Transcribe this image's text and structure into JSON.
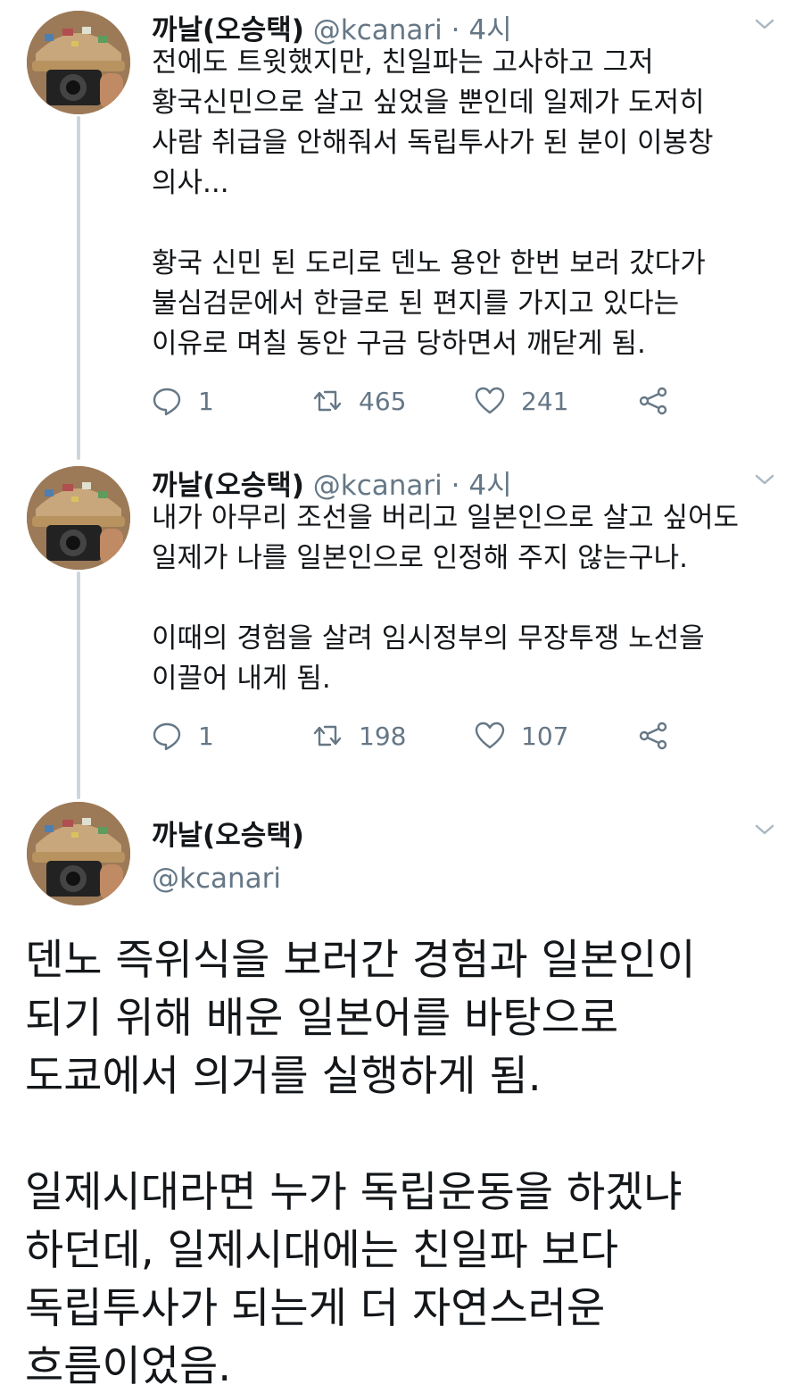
{
  "tweets": [
    {
      "name": "까날(오승택)",
      "handle": "@kcanari",
      "separator": "·",
      "time": "4시",
      "text": "전에도 트윗했지만, 친일파는 고사하고 그저\n황국신민으로 살고 싶었을 뿐인데 일제가 도저히\n사람 취급을 안해줘서 독립투사가 된 분이 이봉창\n의사...\n\n황국 신민 된 도리로 덴노 용안 한번 보러 갔다가\n불심검문에서 한글로 된 편지를 가지고 있다는\n이유로 며칠 동안 구금 당하면서 깨닫게 됨.",
      "replies": "1",
      "retweets": "465",
      "likes": "241"
    },
    {
      "name": "까날(오승택)",
      "handle": "@kcanari",
      "separator": "·",
      "time": "4시",
      "text": "내가 아무리 조선을 버리고 일본인으로 살고 싶어도\n일제가 나를 일본인으로 인정해 주지 않는구나.\n\n이때의 경험을 살려 임시정부의 무장투쟁 노선을\n이끌어 내게 됨.",
      "replies": "1",
      "retweets": "198",
      "likes": "107"
    }
  ],
  "main_tweet": {
    "name": "까날(오승택)",
    "handle": "@kcanari",
    "text": "덴노 즉위식을 보러간 경험과 일본인이\n되기 위해 배운 일본어를 바탕으로\n도쿄에서 의거를 실행하게 됨.\n\n일제시대라면 누가 독립운동을 하겠냐\n하던데, 일제시대에는 친일파 보다\n독립투사가 되는게 더 자연스러운\n흐름이었음."
  },
  "icons": {
    "reply": "reply-icon",
    "retweet": "retweet-icon",
    "like": "heart-icon",
    "share": "share-icon",
    "menu": "chevron-down-icon"
  },
  "colors": {
    "text": "#14171a",
    "secondary": "#657786",
    "thread_line": "#ccd6dd"
  }
}
